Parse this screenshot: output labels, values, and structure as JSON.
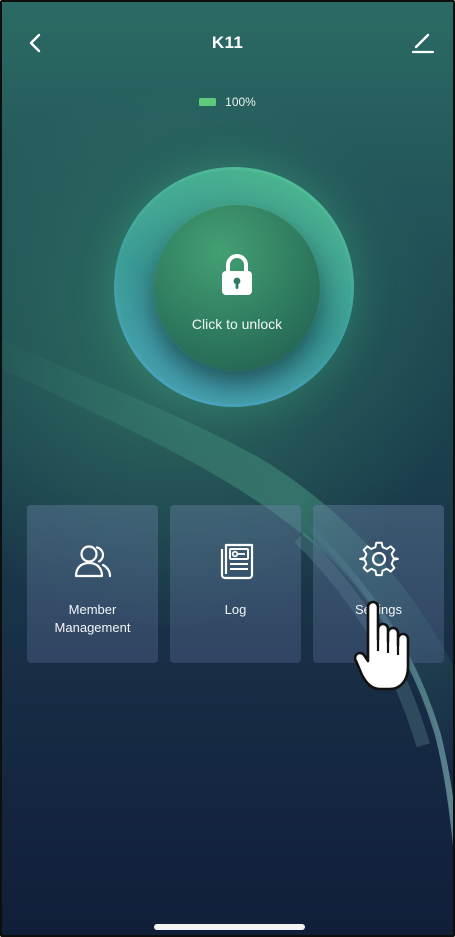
{
  "header": {
    "title": "K11",
    "back_icon": "chevron-left-icon",
    "edit_icon": "pencil-icon"
  },
  "battery": {
    "level_text": "100%",
    "level": 1.0,
    "color": "#5ecb7c"
  },
  "unlock": {
    "label": "Click to unlock",
    "icon": "lock-icon"
  },
  "cards": [
    {
      "label_line1": "Member",
      "label_line2": "Management",
      "icon": "members-icon"
    },
    {
      "label": "Log",
      "icon": "log-icon"
    },
    {
      "label": "Settings",
      "icon": "gear-icon"
    }
  ],
  "colors": {
    "accent": "#4fbf8f",
    "background_top": "#2b6b64",
    "background_bottom": "#101f38"
  }
}
